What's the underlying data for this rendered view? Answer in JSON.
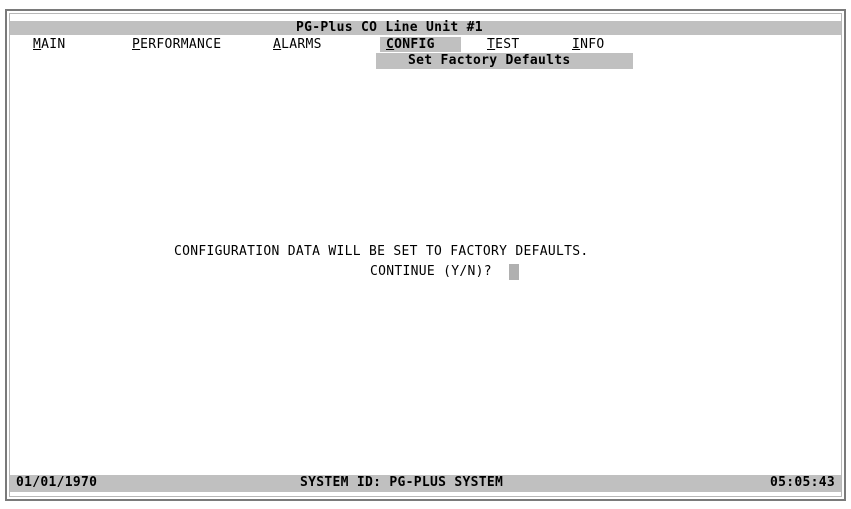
{
  "title": "PG-Plus CO Line Unit #1",
  "menu": {
    "main": {
      "hotkey": "M",
      "rest": "AIN"
    },
    "performance": {
      "hotkey": "P",
      "rest": "ERFORMANCE"
    },
    "alarms": {
      "hotkey": "A",
      "rest": "LARMS"
    },
    "config": {
      "hotkey": "C",
      "rest": "ONFIG"
    },
    "test": {
      "hotkey": "T",
      "rest": "EST"
    },
    "info": {
      "hotkey": "I",
      "rest": "NFO"
    }
  },
  "submenu": {
    "label": "Set Factory Defaults"
  },
  "message": {
    "line1": "CONFIGURATION DATA WILL BE SET TO FACTORY DEFAULTS.",
    "line2": "CONTINUE (Y/N)?"
  },
  "status": {
    "date": "01/01/1970",
    "system_id": "SYSTEM ID: PG-PLUS SYSTEM",
    "time": "05:05:43"
  },
  "colors": {
    "bar": "#c0c0c0",
    "frame": "#7a7a7a",
    "cursor": "#b0b0b0"
  }
}
